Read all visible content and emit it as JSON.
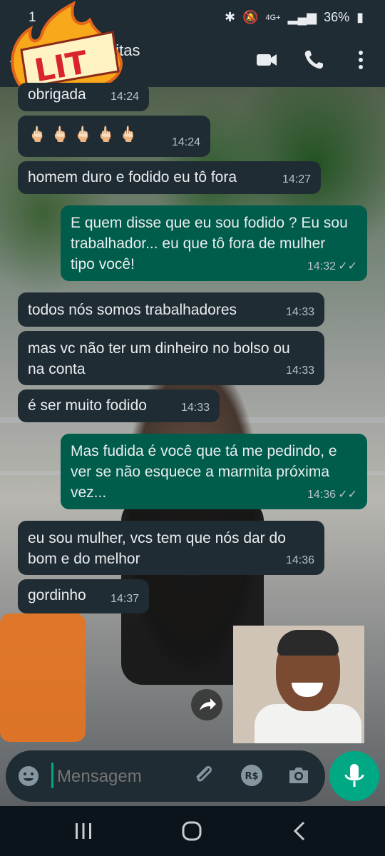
{
  "status": {
    "time": "1",
    "battery": "36%",
    "network": "4G+"
  },
  "header": {
    "contact_name": "eitas",
    "subtitle": "e",
    "sticker_text": "LIT"
  },
  "messages": [
    {
      "dir": "in",
      "text": "obrigada",
      "time": "14:24"
    },
    {
      "dir": "in",
      "text": "🖕🏻 🖕🏻 🖕🏻 🖕🏻 🖕🏻",
      "time": "14:24"
    },
    {
      "dir": "in",
      "text": "homem duro e fodido eu tô fora",
      "time": "14:27"
    },
    {
      "dir": "out",
      "text": "E quem disse que eu sou fodido ? Eu sou trabalhador... eu que tô fora de mulher tipo você!",
      "time": "14:32"
    },
    {
      "dir": "in",
      "text": "todos nós somos trabalhadores",
      "time": "14:33"
    },
    {
      "dir": "in",
      "text": "mas vc não ter um dinheiro no bolso ou na conta",
      "time": "14:33"
    },
    {
      "dir": "in",
      "text": "é ser muito fodido",
      "time": "14:33"
    },
    {
      "dir": "out",
      "text": "Mas fudida é você que tá me pedindo, e ver se não esquece a marmita próxima vez...",
      "time": "14:36"
    },
    {
      "dir": "in",
      "text": "eu sou mulher, vcs tem que nós dar do bom e do melhor",
      "time": "14:36"
    },
    {
      "dir": "in",
      "text": "gordinho",
      "time": "14:37"
    }
  ],
  "composer": {
    "placeholder": "Mensagem",
    "pay_label": "R$"
  },
  "colors": {
    "incoming": "#202c33",
    "outgoing": "#005c4b",
    "accent": "#00a884"
  }
}
